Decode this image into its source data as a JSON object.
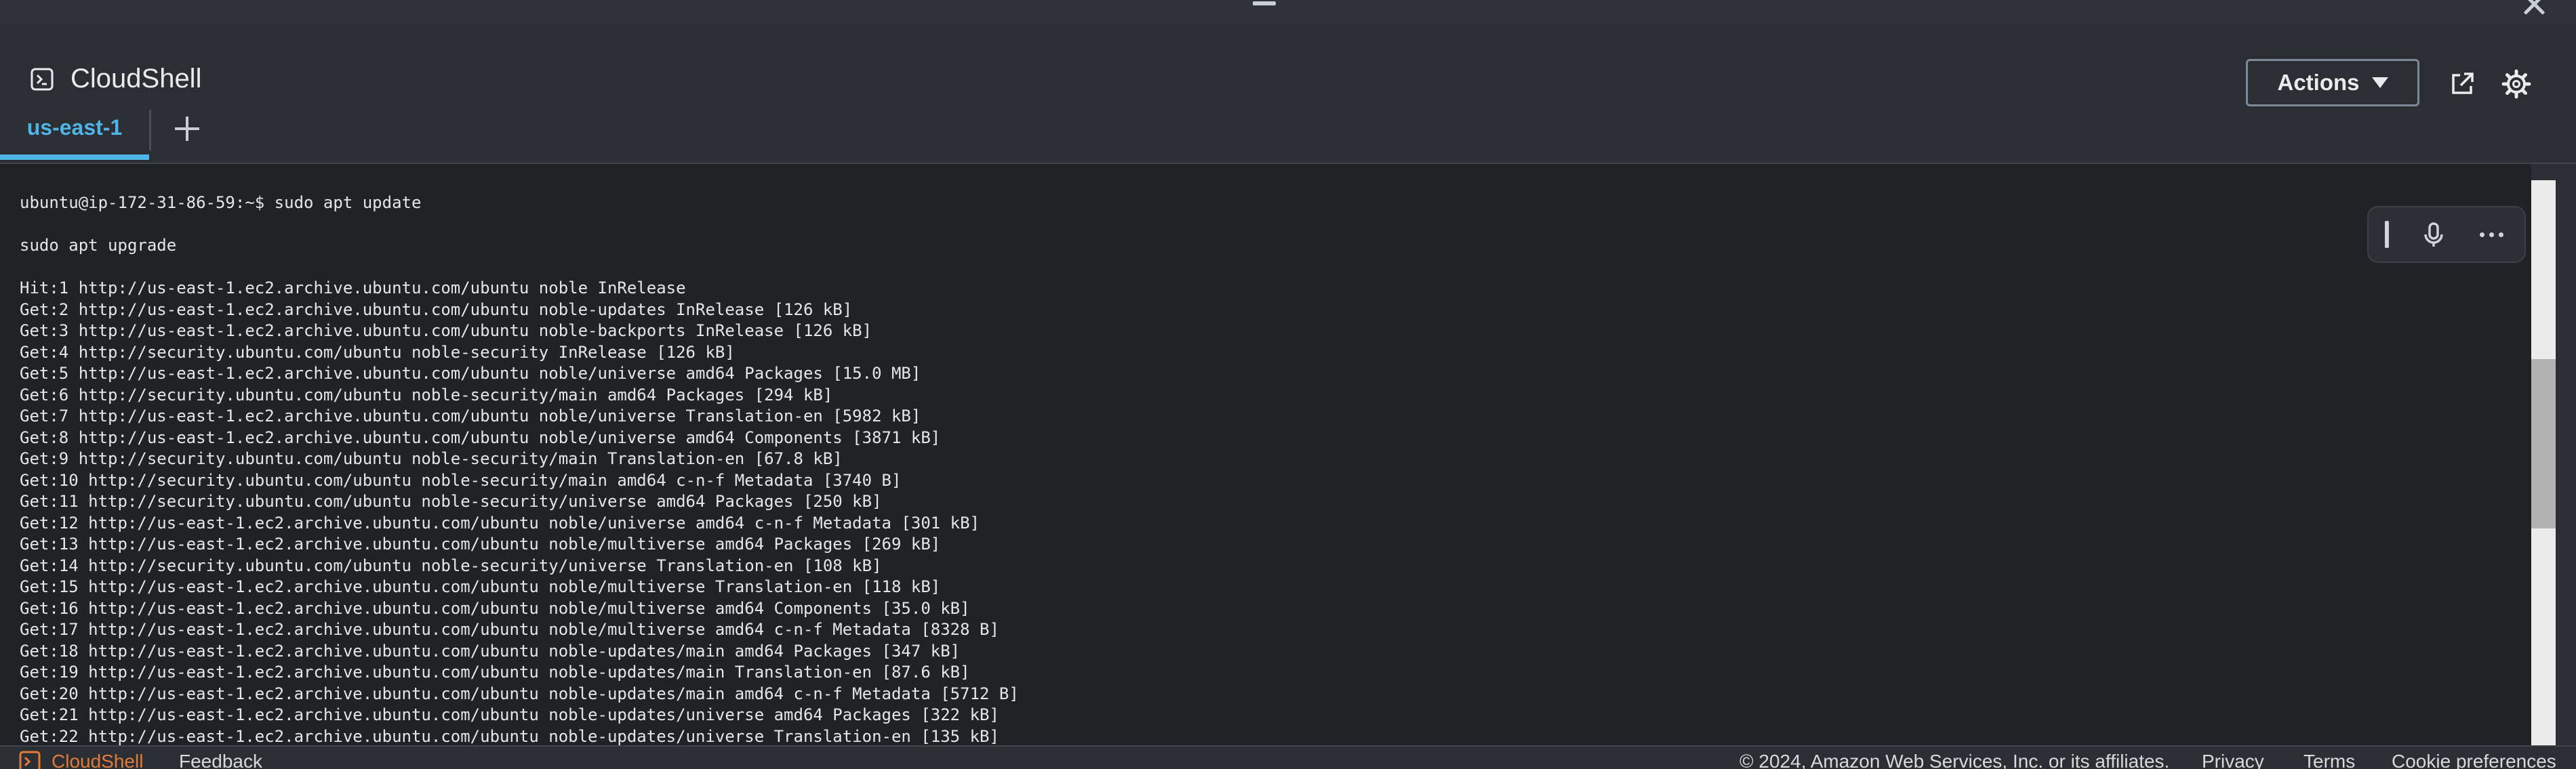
{
  "header": {
    "title": "CloudShell",
    "actions_label": "Actions"
  },
  "tabs": {
    "active_label": "us-east-1"
  },
  "terminal": {
    "lines": [
      "ubuntu@ip-172-31-86-59:~$ sudo apt update",
      "",
      "sudo apt upgrade",
      "",
      "Hit:1 http://us-east-1.ec2.archive.ubuntu.com/ubuntu noble InRelease",
      "Get:2 http://us-east-1.ec2.archive.ubuntu.com/ubuntu noble-updates InRelease [126 kB]",
      "Get:3 http://us-east-1.ec2.archive.ubuntu.com/ubuntu noble-backports InRelease [126 kB]",
      "Get:4 http://security.ubuntu.com/ubuntu noble-security InRelease [126 kB]",
      "Get:5 http://us-east-1.ec2.archive.ubuntu.com/ubuntu noble/universe amd64 Packages [15.0 MB]",
      "Get:6 http://security.ubuntu.com/ubuntu noble-security/main amd64 Packages [294 kB]",
      "Get:7 http://us-east-1.ec2.archive.ubuntu.com/ubuntu noble/universe Translation-en [5982 kB]",
      "Get:8 http://us-east-1.ec2.archive.ubuntu.com/ubuntu noble/universe amd64 Components [3871 kB]",
      "Get:9 http://security.ubuntu.com/ubuntu noble-security/main Translation-en [67.8 kB]",
      "Get:10 http://security.ubuntu.com/ubuntu noble-security/main amd64 c-n-f Metadata [3740 B]",
      "Get:11 http://security.ubuntu.com/ubuntu noble-security/universe amd64 Packages [250 kB]",
      "Get:12 http://us-east-1.ec2.archive.ubuntu.com/ubuntu noble/universe amd64 c-n-f Metadata [301 kB]",
      "Get:13 http://us-east-1.ec2.archive.ubuntu.com/ubuntu noble/multiverse amd64 Packages [269 kB]",
      "Get:14 http://security.ubuntu.com/ubuntu noble-security/universe Translation-en [108 kB]",
      "Get:15 http://us-east-1.ec2.archive.ubuntu.com/ubuntu noble/multiverse Translation-en [118 kB]",
      "Get:16 http://us-east-1.ec2.archive.ubuntu.com/ubuntu noble/multiverse amd64 Components [35.0 kB]",
      "Get:17 http://us-east-1.ec2.archive.ubuntu.com/ubuntu noble/multiverse amd64 c-n-f Metadata [8328 B]",
      "Get:18 http://us-east-1.ec2.archive.ubuntu.com/ubuntu noble-updates/main amd64 Packages [347 kB]",
      "Get:19 http://us-east-1.ec2.archive.ubuntu.com/ubuntu noble-updates/main Translation-en [87.6 kB]",
      "Get:20 http://us-east-1.ec2.archive.ubuntu.com/ubuntu noble-updates/main amd64 c-n-f Metadata [5712 B]",
      "Get:21 http://us-east-1.ec2.archive.ubuntu.com/ubuntu noble-updates/universe amd64 Packages [322 kB]",
      "Get:22 http://us-east-1.ec2.archive.ubuntu.com/ubuntu noble-updates/universe Translation-en [135 kB]"
    ]
  },
  "footer": {
    "cloudshell_label": "CloudShell",
    "feedback_label": "Feedback",
    "copyright": "© 2024, Amazon Web Services, Inc. or its affiliates.",
    "privacy_label": "Privacy",
    "terms_label": "Terms",
    "cookie_label": "Cookie preferences"
  },
  "colors": {
    "accent": "#4fb4e8",
    "background": "#2b2f33",
    "terminal_bg": "#202326"
  },
  "icons": [
    "minimize-icon",
    "close-icon",
    "cloudshell-icon",
    "caret-down-icon",
    "external-link-icon",
    "gear-icon",
    "add-tab-icon",
    "microphone-icon",
    "more-icon"
  ]
}
